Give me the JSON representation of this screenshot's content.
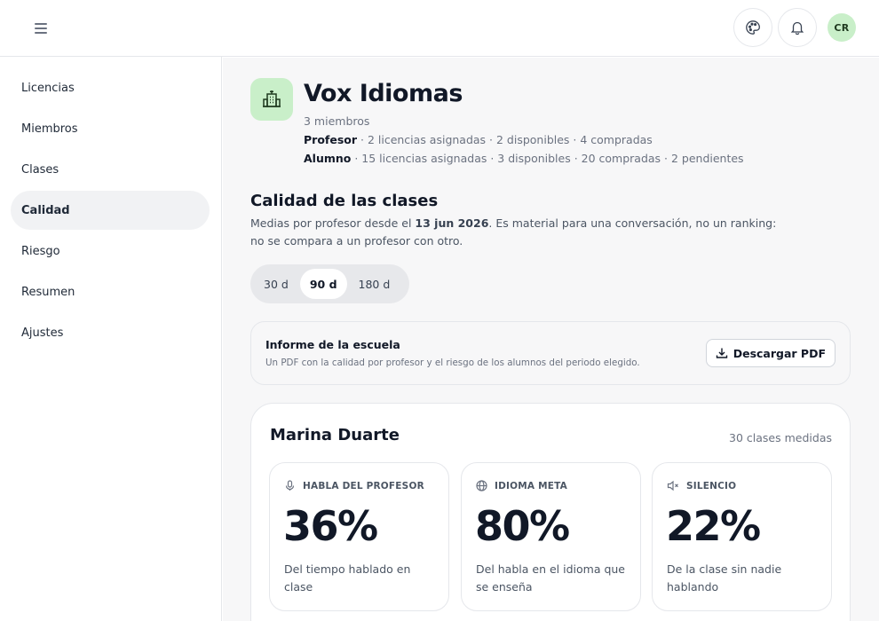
{
  "header": {
    "avatar_initials": "CR",
    "icons": [
      "menu-icon",
      "palette-icon",
      "bell-icon"
    ]
  },
  "sidebar": {
    "items": [
      {
        "label": "Licencias"
      },
      {
        "label": "Miembros"
      },
      {
        "label": "Clases"
      },
      {
        "label": "Calidad",
        "active": true
      },
      {
        "label": "Riesgo"
      },
      {
        "label": "Resumen"
      },
      {
        "label": "Ajustes"
      }
    ]
  },
  "organization": {
    "name": "Vox Idiomas",
    "members": "3 miembros",
    "roles": [
      {
        "role": "Profesor",
        "details": " · 2 licencias asignadas · 2 disponibles · 4 compradas"
      },
      {
        "role": "Alumno",
        "details": " · 15 licencias asignadas · 3 disponibles · 20 compradas · 2 pendientes"
      }
    ]
  },
  "quality": {
    "title": "Calidad de las clases",
    "desc_prefix": "Medias por profesor desde el ",
    "desc_date": "13 jun 2026",
    "desc_suffix": ". Es material para una conversación, no un ranking: no se compara a un profesor con otro.",
    "periods": [
      "30 d",
      "90 d",
      "180 d"
    ],
    "selected_period": "90 d"
  },
  "report": {
    "title": "Informe de la escuela",
    "description": "Un PDF con la calidad por profesor y el riesgo de los alumnos del periodo elegido.",
    "button_label": "Descargar PDF"
  },
  "teacher_card": {
    "name": "Marina Duarte",
    "count": "30 clases medidas",
    "metrics": [
      {
        "icon": "microphone-icon",
        "label": "HABLA DEL PROFESOR",
        "value": "36%",
        "description": "Del tiempo hablado en clase"
      },
      {
        "icon": "globe-icon",
        "label": "IDIOMA META",
        "value": "80%",
        "description": "Del habla en el idioma que se enseña"
      },
      {
        "icon": "speaker-muted-icon",
        "label": "SILENCIO",
        "value": "22%",
        "description": "De la clase sin nadie hablando"
      }
    ]
  },
  "colors": {
    "accent_green": "#c9efc9",
    "icon_green": "#1f3a1f",
    "active_nav": "#f1f2f4",
    "main_bg": "#f7f7f8"
  }
}
